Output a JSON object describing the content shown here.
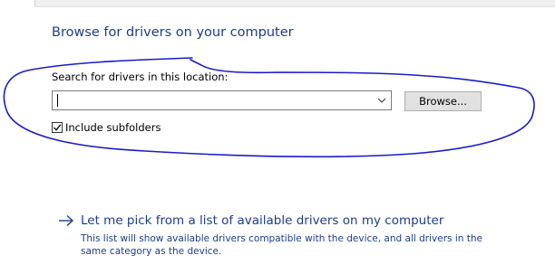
{
  "page_title": "Browse for drivers on your computer",
  "search": {
    "label": "Search for drivers in this location:",
    "value": "",
    "browse_label": "Browse...",
    "include_subfolders_label": "Include subfolders",
    "include_subfolders_checked": true
  },
  "pick_option": {
    "title": "Let me pick from a list of available drivers on my computer",
    "description": "This list will show available drivers compatible with the device, and all drivers in the same category as the device.",
    "icon": "arrow-right-icon"
  },
  "annotation": {
    "color": "#1a1acc",
    "shape": "hand-drawn-circle"
  },
  "colors": {
    "heading": "#1e3c8f",
    "link": "#1e3c8f"
  }
}
